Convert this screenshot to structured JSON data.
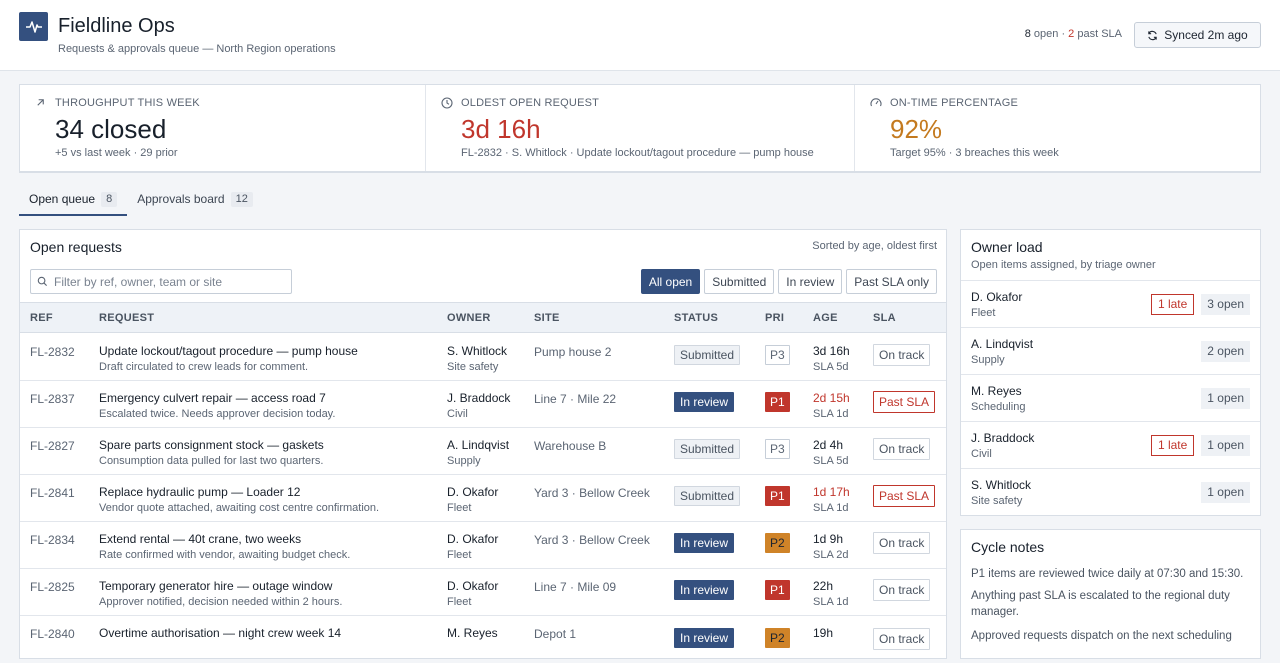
{
  "header": {
    "title": "Fieldline Ops",
    "subtitle": "Requests & approvals queue — North Region operations",
    "open_count": "8",
    "open_label": "open",
    "separator": "·",
    "past_sla_count": "2",
    "past_sla_label": "past SLA",
    "sync_label": "Synced 2m ago"
  },
  "kpis": [
    {
      "label": "THROUGHPUT THIS WEEK",
      "value": "34 closed",
      "sub": "+5 vs last week · 29 prior",
      "icon": "arrow-up-right-icon",
      "color": "#18202b"
    },
    {
      "label": "OLDEST OPEN REQUEST",
      "value": "3d 16h",
      "sub": "FL-2832 · S. Whitlock · Update lockout/tagout procedure — pump house",
      "icon": "clock-icon",
      "color": "#c0362c"
    },
    {
      "label": "ON-TIME PERCENTAGE",
      "value": "92%",
      "sub": "Target 95% · 3 breaches this week",
      "icon": "gauge-icon",
      "color": "#c47a1f"
    }
  ],
  "tabs": [
    {
      "label": "Open queue",
      "count": "8",
      "active": true
    },
    {
      "label": "Approvals board",
      "count": "12",
      "active": false
    }
  ],
  "queue": {
    "title": "Open requests",
    "sort_note": "Sorted by age, oldest first",
    "filter_placeholder": "Filter by ref, owner, team or site",
    "filters": [
      "All open",
      "Submitted",
      "In review",
      "Past SLA only"
    ],
    "columns": [
      "REF",
      "REQUEST",
      "OWNER",
      "SITE",
      "STATUS",
      "PRI",
      "AGE",
      "SLA"
    ],
    "rows": [
      {
        "ref": "FL-2832",
        "title": "Update lockout/tagout procedure — pump house",
        "detail": "Draft circulated to crew leads for comment.",
        "owner": "S. Whitlock",
        "team": "Site safety",
        "site": "Pump house 2",
        "status": "Submitted",
        "priority": "P3",
        "age": "3d 16h",
        "age_late": false,
        "sla": "SLA 5d",
        "sla_state": "On track"
      },
      {
        "ref": "FL-2837",
        "title": "Emergency culvert repair — access road 7",
        "detail": "Escalated twice. Needs approver decision today.",
        "owner": "J. Braddock",
        "team": "Civil",
        "site": "Line 7 · Mile 22",
        "status": "In review",
        "priority": "P1",
        "age": "2d 15h",
        "age_late": true,
        "sla": "SLA 1d",
        "sla_state": "Past SLA"
      },
      {
        "ref": "FL-2827",
        "title": "Spare parts consignment stock — gaskets",
        "detail": "Consumption data pulled for last two quarters.",
        "owner": "A. Lindqvist",
        "team": "Supply",
        "site": "Warehouse B",
        "status": "Submitted",
        "priority": "P3",
        "age": "2d 4h",
        "age_late": false,
        "sla": "SLA 5d",
        "sla_state": "On track"
      },
      {
        "ref": "FL-2841",
        "title": "Replace hydraulic pump — Loader 12",
        "detail": "Vendor quote attached, awaiting cost centre confirmation.",
        "owner": "D. Okafor",
        "team": "Fleet",
        "site": "Yard 3 · Bellow Creek",
        "status": "Submitted",
        "priority": "P1",
        "age": "1d 17h",
        "age_late": true,
        "sla": "SLA 1d",
        "sla_state": "Past SLA"
      },
      {
        "ref": "FL-2834",
        "title": "Extend rental — 40t crane, two weeks",
        "detail": "Rate confirmed with vendor, awaiting budget check.",
        "owner": "D. Okafor",
        "team": "Fleet",
        "site": "Yard 3 · Bellow Creek",
        "status": "In review",
        "priority": "P2",
        "age": "1d 9h",
        "age_late": false,
        "sla": "SLA 2d",
        "sla_state": "On track"
      },
      {
        "ref": "FL-2825",
        "title": "Temporary generator hire — outage window",
        "detail": "Approver notified, decision needed within 2 hours.",
        "owner": "D. Okafor",
        "team": "Fleet",
        "site": "Line 7 · Mile 09",
        "status": "In review",
        "priority": "P1",
        "age": "22h",
        "age_late": false,
        "sla": "SLA 1d",
        "sla_state": "On track"
      },
      {
        "ref": "FL-2840",
        "title": "Overtime authorisation — night crew week 14",
        "detail": "",
        "owner": "M. Reyes",
        "team": "",
        "site": "Depot 1",
        "status": "In review",
        "priority": "P2",
        "age": "19h",
        "age_late": false,
        "sla": "",
        "sla_state": "On track"
      }
    ]
  },
  "owner_load": {
    "title": "Owner load",
    "subtitle": "Open items assigned, by triage owner",
    "owners": [
      {
        "name": "D. Okafor",
        "team": "Fleet",
        "late": "1 late",
        "open": "3 open"
      },
      {
        "name": "A. Lindqvist",
        "team": "Supply",
        "late": "",
        "open": "2 open"
      },
      {
        "name": "M. Reyes",
        "team": "Scheduling",
        "late": "",
        "open": "1 open"
      },
      {
        "name": "J. Braddock",
        "team": "Civil",
        "late": "1 late",
        "open": "1 open"
      },
      {
        "name": "S. Whitlock",
        "team": "Site safety",
        "late": "",
        "open": "1 open"
      }
    ]
  },
  "cycle_notes": {
    "title": "Cycle notes",
    "notes": [
      "P1 items are reviewed twice daily at 07:30 and 15:30.",
      "Anything past SLA is escalated to the regional duty manager.",
      "Approved requests dispatch on the next scheduling"
    ]
  },
  "colors": {
    "accent": "#34507f",
    "danger": "#c0362c",
    "warning": "#c47a1f",
    "priority_p2": "#cf8328"
  }
}
